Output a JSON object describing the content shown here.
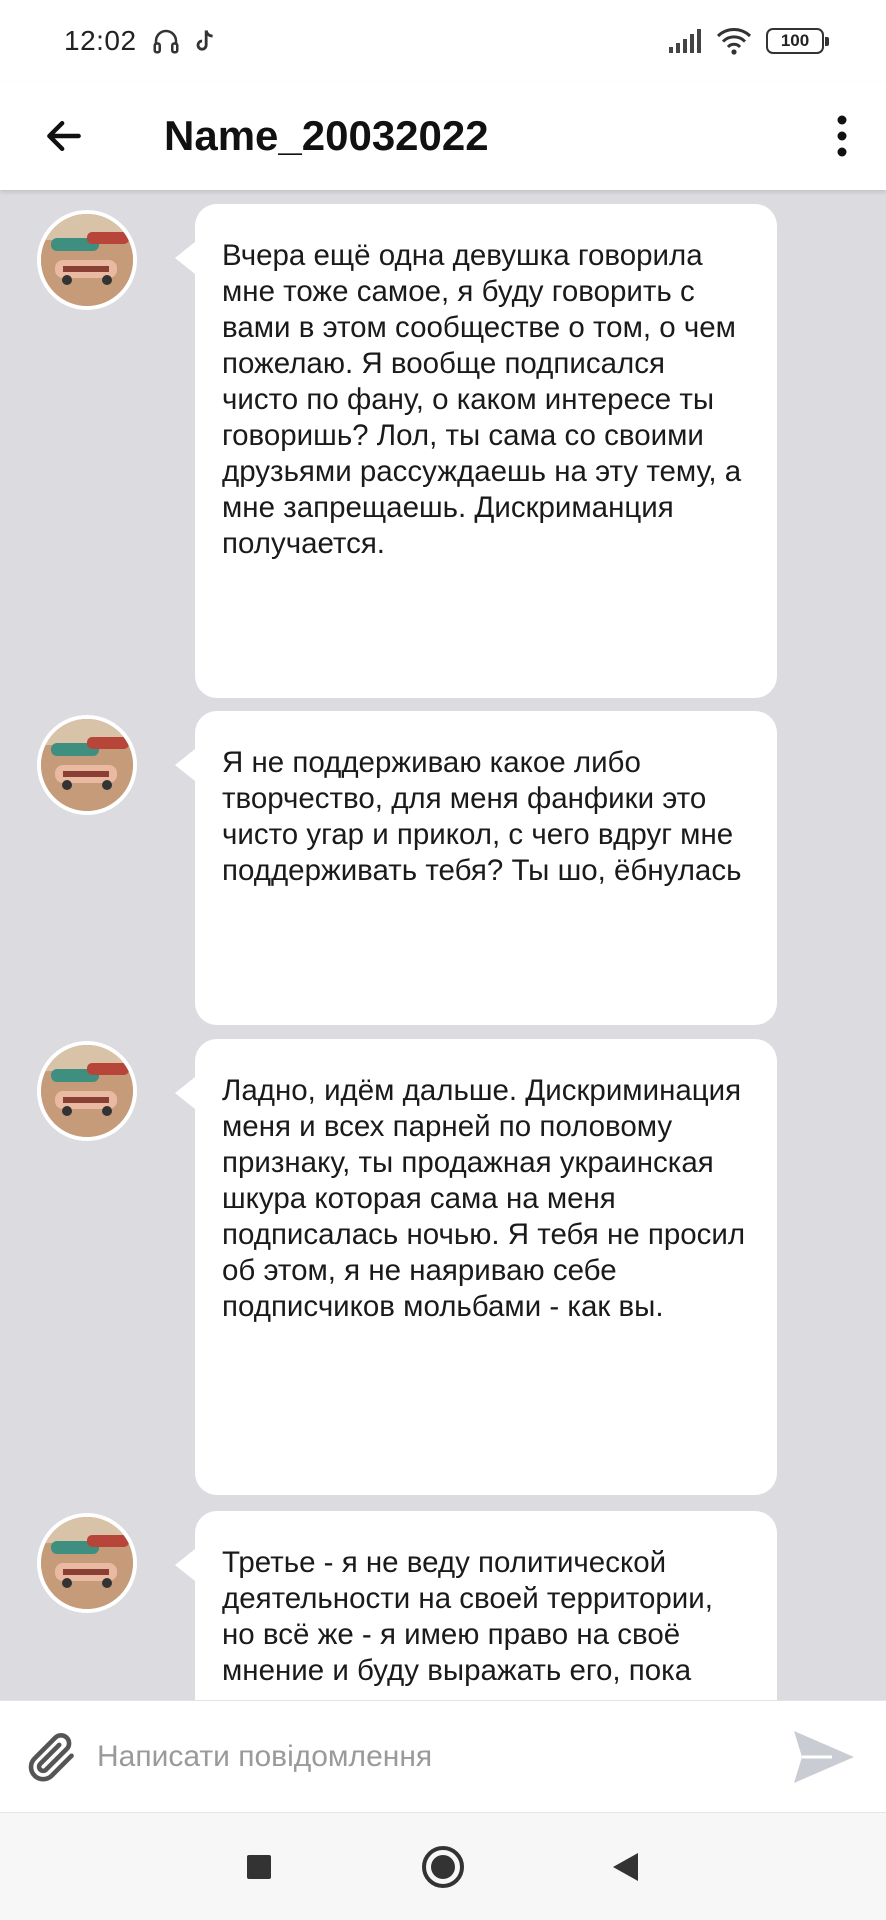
{
  "status_bar": {
    "time": "12:02",
    "icons_left": [
      "headphones-icon",
      "tiktok-icon"
    ],
    "icons_right": [
      "signal-icon",
      "wifi-icon"
    ],
    "battery_level": "100"
  },
  "app_bar": {
    "title": "Name_20032022",
    "back_icon": "arrow-left-icon",
    "menu_icon": "more-vertical-icon"
  },
  "messages": [
    {
      "text": "Вчера ещё одна девушка говорила мне тоже самое, я буду говорить с вами в этом сообществе о том, о чем пожелаю. Я вообще подписался чисто по фану, о каком интересе ты говоришь? Лол, ты сама со своими друзьями рассуждаешь на эту тему, а мне запрещаешь. Дискриманция получается."
    },
    {
      "text": "Я не поддерживаю какое либо творчество, для меня фанфики это чисто угар и прикол, с чего вдруг мне поддерживать тебя? Ты шо, ёбнулась"
    },
    {
      "text": "Ладно, идём дальше. Дискриминация меня и всех парней по половому признаку, ты продажная украинская шкура которая сама на меня подписалась ночью. Я тебя не просил об этом, я не наяриваю себе подписчиков мольбами - как вы."
    },
    {
      "text": "Третье - я не веду политической деятельности на своей территории, но всё же - я имею право на своё мнение и буду выражать его, пока меня не"
    }
  ],
  "input_bar": {
    "placeholder": "Написати повідомлення",
    "attach_icon": "paperclip-icon",
    "send_icon": "send-icon"
  },
  "nav_bar": {
    "items": [
      "recents-square-icon",
      "home-circle-icon",
      "back-triangle-icon"
    ]
  },
  "colors": {
    "chat_background": "#dcdbe0",
    "bubble": "#ffffff",
    "placeholder": "#9a9a9a",
    "send_icon": "#c9ccd3"
  }
}
